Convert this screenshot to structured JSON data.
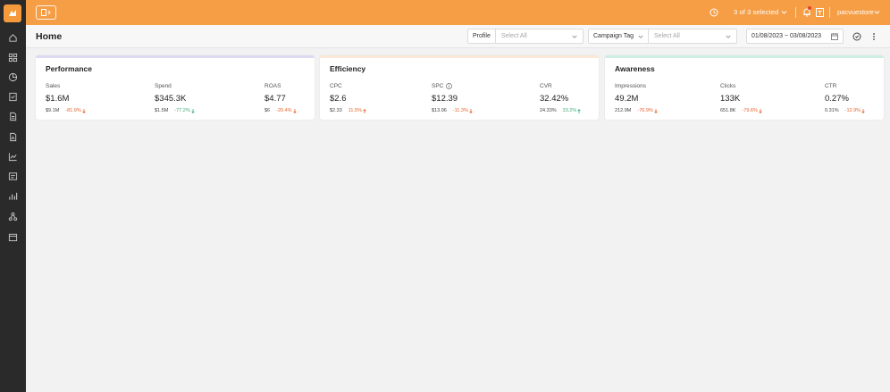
{
  "topbar": {
    "selection": "3 of 3 selected",
    "user": "pacvuestore"
  },
  "header": {
    "title": "Home",
    "profile_label": "Profile",
    "profile_placeholder": "Select All",
    "campaign_tag_label": "Campaign Tag",
    "campaign_tag_placeholder": "Select All",
    "date_range": "01/08/2023 ~ 03/08/2023"
  },
  "colors": {
    "accent": "#f59e46",
    "sidebar": "#2a2a2a",
    "negative": "#e8642e",
    "positive": "#3fae7a",
    "performance_strip": "#dcdaf1",
    "efficiency_strip": "#fbe8d6",
    "awareness_strip": "#cdeee0"
  },
  "cards": {
    "performance": {
      "title": "Performance",
      "metrics": [
        {
          "label": "Sales",
          "value": "$1.6M",
          "prev": "$9.1M",
          "change": "-81.9%",
          "trend": "down"
        },
        {
          "label": "Spend",
          "value": "$345.3K",
          "prev": "$1.5M",
          "change": "-77.2%",
          "trend": "down"
        },
        {
          "label": "ROAS",
          "value": "$4.77",
          "prev": "$6",
          "change": "-20.4%",
          "trend": "down"
        }
      ]
    },
    "efficiency": {
      "title": "Efficiency",
      "metrics": [
        {
          "label": "CPC",
          "value": "$2.6",
          "prev": "$2.33",
          "change": "11.5%",
          "trend": "up"
        },
        {
          "label": "SPC",
          "value": "$12.39",
          "prev": "$13.96",
          "change": "-11.3%",
          "trend": "down"
        },
        {
          "label": "CVR",
          "value": "32.42%",
          "prev": "24.33%",
          "change": "33.2%",
          "trend": "up"
        }
      ]
    },
    "awareness": {
      "title": "Awareness",
      "metrics": [
        {
          "label": "Impressions",
          "value": "49.2M",
          "prev": "212.9M",
          "change": "-76.9%",
          "trend": "down"
        },
        {
          "label": "Clicks",
          "value": "133K",
          "prev": "651.8K",
          "change": "-79.6%",
          "trend": "down"
        },
        {
          "label": "CTR",
          "value": "0.27%",
          "prev": "0.31%",
          "change": "-12.9%",
          "trend": "down"
        }
      ]
    }
  },
  "sidebar_icons": [
    "home-icon",
    "grid-icon",
    "pie-chart-icon",
    "checklist-icon",
    "document-icon",
    "report-icon",
    "line-chart-icon",
    "image-icon",
    "bar-chart-icon",
    "hierarchy-icon",
    "calendar-icon"
  ]
}
